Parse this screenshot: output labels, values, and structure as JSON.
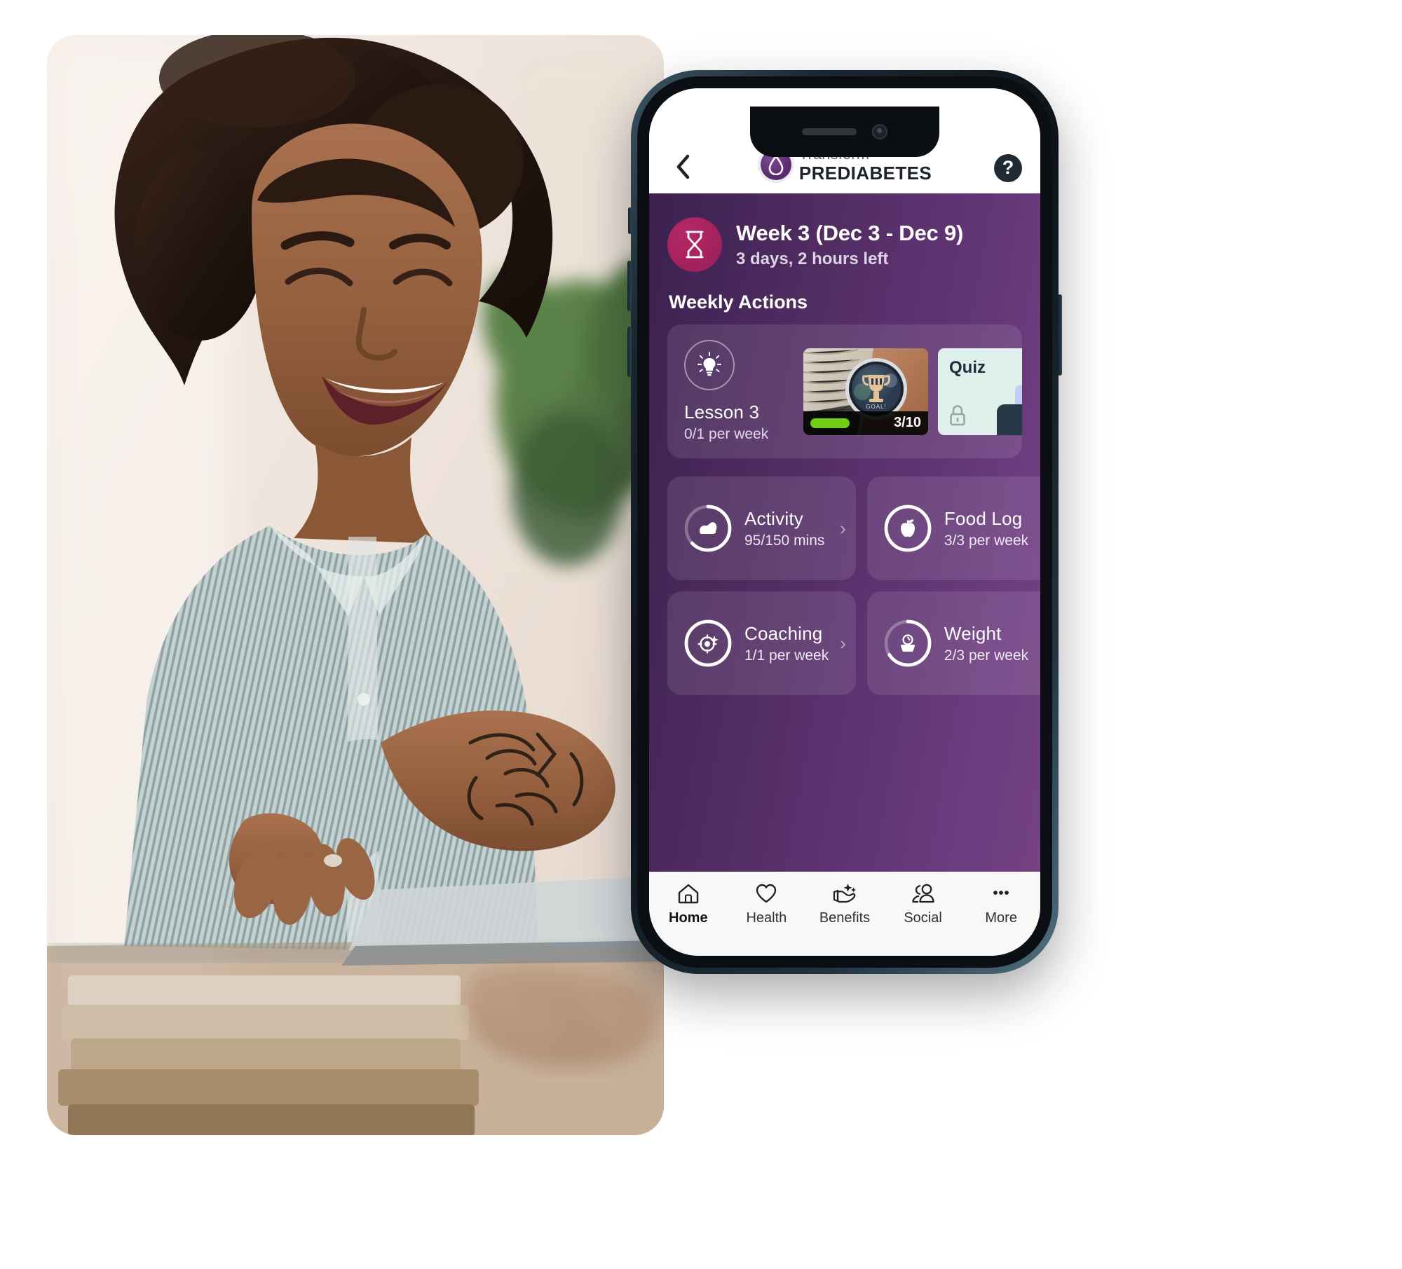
{
  "header": {
    "back_icon": "chevron-left-icon",
    "brand_top": "Transform",
    "brand_bottom": "PREDIABETES",
    "brand_icon": "water-drop-icon",
    "help_label": "?"
  },
  "week_banner": {
    "icon": "hourglass-icon",
    "title": "Week 3 (Dec 3 - Dec 9)",
    "subtitle": "3 days, 2 hours left",
    "accent_color": "#a6225e"
  },
  "weekly_actions": {
    "section_title": "Weekly Actions",
    "lesson": {
      "icon": "lightbulb-icon",
      "name": "Lesson 3",
      "frequency": "0/1 per week"
    },
    "thumbnails": [
      {
        "type": "video",
        "image": "smartwatch-trophy-goal-photo",
        "progress_count": "3/10",
        "progress_color": "#6fce12",
        "watch_label": "GOAL!"
      },
      {
        "type": "quiz",
        "label": "Quiz",
        "locked": true,
        "lock_icon": "lock-icon",
        "background_color": "#dff0ea"
      }
    ]
  },
  "metrics": [
    {
      "name": "Activity",
      "value": "95/150 mins",
      "icon": "shoe-icon",
      "progress": 0.63,
      "chevron": "›"
    },
    {
      "name": "Food Log",
      "value": "3/3 per week",
      "icon": "apple-icon",
      "progress": 1.0,
      "chevron": "›"
    },
    {
      "name": "Coaching",
      "value": "1/1 per week",
      "icon": "coach-target-icon",
      "progress": 1.0,
      "chevron": "›"
    },
    {
      "name": "Weight",
      "value": "2/3 per week",
      "icon": "scale-icon",
      "progress": 0.66,
      "chevron": "›"
    }
  ],
  "tabs": [
    {
      "label": "Home",
      "icon": "home-icon",
      "active": true
    },
    {
      "label": "Health",
      "icon": "heart-icon",
      "active": false
    },
    {
      "label": "Benefits",
      "icon": "hand-sparkle-icon",
      "active": false
    },
    {
      "label": "Social",
      "icon": "people-icon",
      "active": false
    },
    {
      "label": "More",
      "icon": "ellipsis-icon",
      "active": false
    }
  ],
  "theme": {
    "purple_dark": "#3b2150",
    "purple_light": "#74427f",
    "magenta": "#a6225e",
    "brand_purple": "#5f2d72",
    "green": "#6fce12",
    "quiz_mint": "#dff0ea"
  }
}
